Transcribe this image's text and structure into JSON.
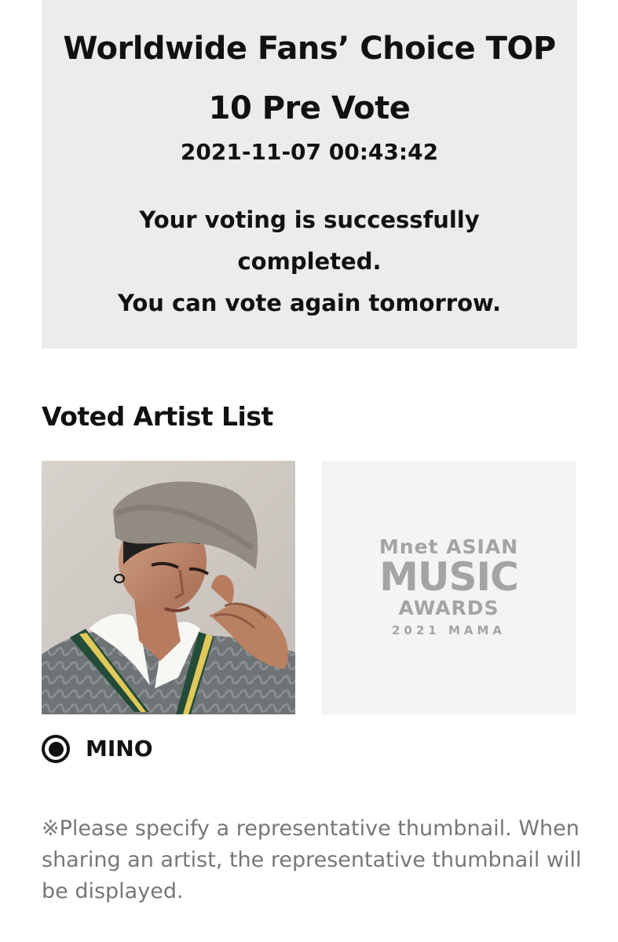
{
  "vote_result": {
    "title": "Worldwide Fans’ Choice TOP 10 Pre Vote",
    "datetime": "2021-11-07 00:43:42",
    "message_line_1": "Your voting is successfully completed.",
    "message_line_2": "You can vote again tomorrow."
  },
  "artist_list": {
    "heading": "Voted Artist List",
    "items": [
      {
        "name": "MINO",
        "thumbnail_icon": "artist-photo-icon",
        "selected": true
      },
      {
        "thumbnail_icon": "mama-logo-icon",
        "logo_lines": [
          "Mnet ASIAN",
          "MUSIC",
          "AWARDS",
          "2021 MAMA"
        ]
      }
    ]
  },
  "note": {
    "text": "※Please specify a representative thumbnail. When sharing an artist, the representative thumbnail will be displayed."
  },
  "colors": {
    "card_background": "#ececec",
    "primary_text": "#111111",
    "note_text": "#777777",
    "logo_gray": "#a4a4a4"
  }
}
